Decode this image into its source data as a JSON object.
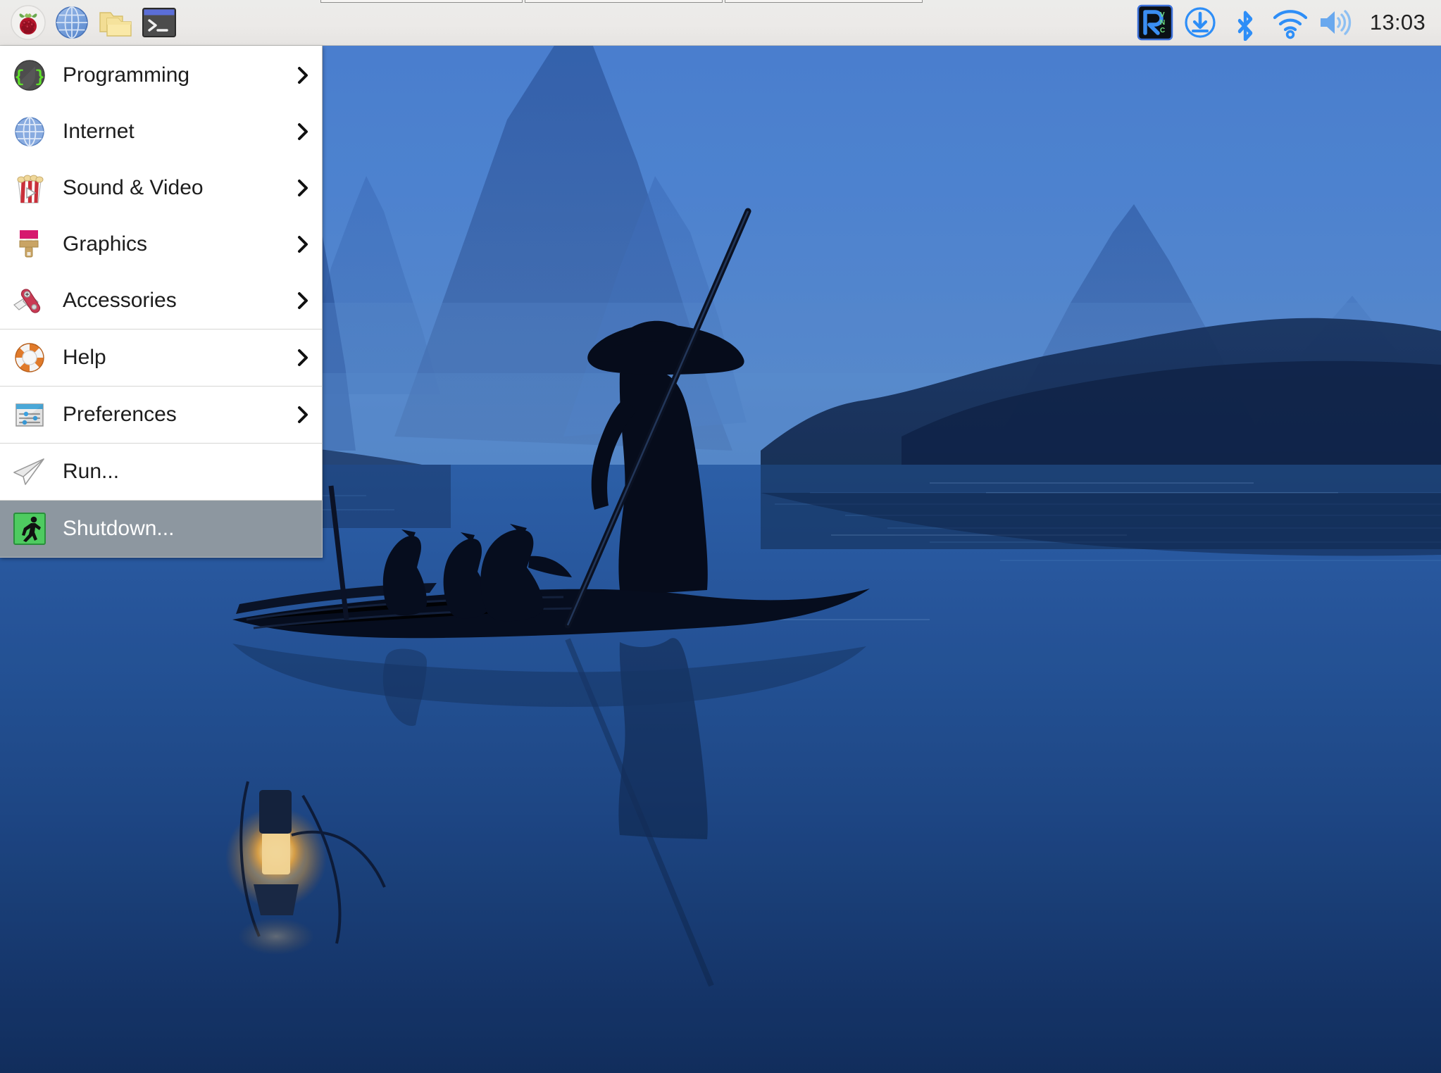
{
  "desktop": {
    "wallpaper_name": "cormorant-fisherman-li-river",
    "wallpaper_colors": {
      "sky_top": "#4a7fd4",
      "sky_mid": "#4f86d8",
      "haze": "#5b8fd6",
      "water_top": "#2a5ca8",
      "water_mid": "#1f4a8a",
      "water_bottom": "#14356b",
      "silhouette": "#0a1226",
      "lantern_glow": "#ffd27a"
    }
  },
  "taskbar": {
    "background": "#ecebe9",
    "launchers": [
      {
        "name": "raspberry-menu-icon",
        "label": "Raspberry Pi Menu"
      },
      {
        "name": "web-browser-icon",
        "label": "Web Browser"
      },
      {
        "name": "file-manager-icon",
        "label": "File Manager"
      },
      {
        "name": "terminal-icon",
        "label": "Terminal"
      }
    ],
    "task_buttons": [
      {
        "name": "task-window-1",
        "label": ""
      },
      {
        "name": "task-window-2",
        "label": ""
      },
      {
        "name": "task-window-3",
        "label": ""
      }
    ],
    "tray": [
      {
        "name": "vnc-icon",
        "label": "RealVNC Server"
      },
      {
        "name": "updates-icon",
        "label": "Updates Available"
      },
      {
        "name": "bluetooth-icon",
        "label": "Bluetooth"
      },
      {
        "name": "wifi-icon",
        "label": "Wireless Network"
      },
      {
        "name": "volume-icon",
        "label": "Volume"
      }
    ],
    "clock": "13:03"
  },
  "menu": {
    "name": "main-menu",
    "items": [
      {
        "label": "Programming",
        "icon": "programming-icon",
        "submenu": true,
        "separator_above": false,
        "highlighted": false
      },
      {
        "label": "Internet",
        "icon": "internet-icon",
        "submenu": true,
        "separator_above": false,
        "highlighted": false
      },
      {
        "label": "Sound & Video",
        "icon": "sound-video-icon",
        "submenu": true,
        "separator_above": false,
        "highlighted": false
      },
      {
        "label": "Graphics",
        "icon": "graphics-icon",
        "submenu": true,
        "separator_above": false,
        "highlighted": false
      },
      {
        "label": "Accessories",
        "icon": "accessories-icon",
        "submenu": true,
        "separator_above": false,
        "highlighted": false
      },
      {
        "label": "Help",
        "icon": "help-icon",
        "submenu": true,
        "separator_above": true,
        "highlighted": false
      },
      {
        "label": "Preferences",
        "icon": "preferences-icon",
        "submenu": true,
        "separator_above": true,
        "highlighted": false
      },
      {
        "label": "Run...",
        "icon": "run-icon",
        "submenu": false,
        "separator_above": true,
        "highlighted": false
      },
      {
        "label": "Shutdown...",
        "icon": "shutdown-icon",
        "submenu": false,
        "separator_above": true,
        "highlighted": true
      }
    ],
    "highlight_color": "#8d97a0"
  }
}
